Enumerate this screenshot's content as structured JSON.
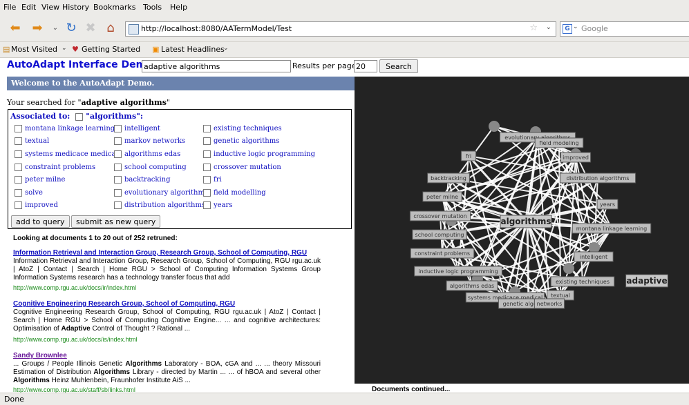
{
  "menu": [
    "File",
    "Edit",
    "View",
    "History",
    "Bookmarks",
    "Tools",
    "Help"
  ],
  "url": "http://localhost:8080/AATermModel/Test",
  "search_engine_placeholder": "Google",
  "bookmarks": [
    "Most Visited",
    "Getting Started",
    "Latest Headlines"
  ],
  "header": {
    "title": "AutoAdapt Interface Demo:",
    "query": "adaptive algorithms",
    "rpp_label": "Results per page:",
    "rpp_value": "20",
    "search_label": "Search"
  },
  "welcome": "Welcome to the AutoAdapt Demo.",
  "searched_prefix": "Your searched for \"",
  "searched_term": "adaptive algorithms",
  "searched_suffix": "\"",
  "assoc": {
    "label": "Associated to:",
    "term": "\"algorithms\":",
    "col1": [
      "montana linkage learning",
      "textual",
      "systems medicace medical",
      "constraint problems",
      "peter milne",
      "solve",
      "improved"
    ],
    "col2": [
      "intelligent",
      "markov networks",
      "algorithms edas",
      "school computing",
      "backtracking",
      "evolutionary algorithms",
      "distribution algorithms"
    ],
    "col3": [
      "existing techniques",
      "genetic algorithms",
      "inductive logic programming",
      "crossover mutation",
      "fri",
      "field modelling",
      "years"
    ],
    "add_label": "add to query",
    "submit_label": "submit as new query"
  },
  "looking": "Looking at documents 1 to 20 out of 252 retruned:",
  "results": [
    {
      "title": "Information Retrieval and Interaction Group, Research Group, School of Computing, RGU",
      "snippet": "Information Retrieval and Interaction Group, Research Group, School of Computing, RGU rgu.ac.uk | AtoZ | Contact | Search | Home RGU > School of Computing Information Systems Group Information Systems research has a technology transfer focus that add",
      "url": "http://www.comp.rgu.ac.uk/docs/ir/index.html"
    },
    {
      "title": "Cognitive Engineering Research Group, School of Computing, RGU",
      "snippet_a": "Cognitive Engineering Research Group, School of Computing, RGU rgu.ac.uk | AtoZ | Contact | Search | Home RGU > School of Computing Cognitive Engine... ... and cognitive architectures: Optimisation of ",
      "snippet_bold": "Adaptive",
      "snippet_b": " Control of Thought ? Rational ...",
      "url": "http://www.comp.rgu.ac.uk/docs/is/index.html"
    },
    {
      "title": "Sandy Brownlee",
      "s1": "... Groups / People Illinois Genetic ",
      "b1": "Algorithms",
      "s2": " Laboratory - BOA, cGA and ... ... theory Missouri Estimation of Distribution ",
      "b2": "Algorithms",
      "s3": " Library - directed by Martin ... ... of hBOA and several other ",
      "b3": "Algorithms",
      "s4": " Heinz Muhlenbein, Fraunhofer Institute AiS ...",
      "url": "http://www.comp.rgu.ac.uk/staff/sb/links.html"
    }
  ],
  "docs_continued": "Documents continued...",
  "status": "Done",
  "graph": {
    "center": "algorithms",
    "query_node": "adaptive",
    "nodes": [
      "evolutionary algorithms",
      "field modeling",
      "fri",
      "improved",
      "backtracking",
      "distribution algorithms",
      "peter milne",
      "years",
      "crossover mutation",
      "montana linkage learning",
      "school computing",
      "constraint problems",
      "intelligent",
      "inductive logic programming",
      "existing techniques",
      "algorithms edas",
      "textual",
      "systems medicace medical",
      "genetic algorithms",
      "networks"
    ]
  },
  "colors": {
    "graph_bg": "#232323",
    "welcome_bg": "#6b83ae",
    "link": "#1010c0",
    "url_green": "#1a8a1a"
  }
}
